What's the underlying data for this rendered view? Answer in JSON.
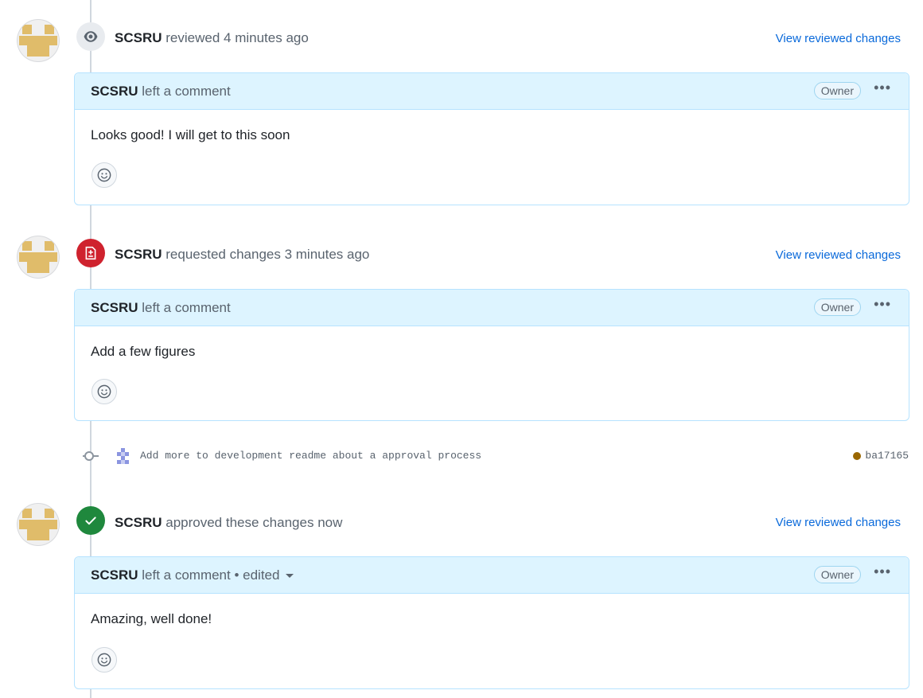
{
  "reviews": [
    {
      "author": "SCSRU",
      "action": "reviewed",
      "time": "4 minutes ago",
      "view_link": "View reviewed changes",
      "comment_author": "SCSRU",
      "comment_action": "left a comment",
      "role": "Owner",
      "body": "Looks good! I will get to this soon",
      "icon": "eye-icon"
    },
    {
      "author": "SCSRU",
      "action": "requested changes",
      "time": "3 minutes ago",
      "view_link": "View reviewed changes",
      "comment_author": "SCSRU",
      "comment_action": "left a comment",
      "role": "Owner",
      "body": "Add a few figures",
      "icon": "file-diff-icon"
    },
    {
      "author": "SCSRU",
      "action": "approved these changes",
      "time": "now",
      "view_link": "View reviewed changes",
      "comment_author": "SCSRU",
      "comment_action": "left a comment • edited",
      "role": "Owner",
      "body": "Amazing, well done!",
      "icon": "check-icon"
    }
  ],
  "commit": {
    "message": "Add more to development readme about a approval process",
    "sha": "ba17165",
    "status_color": "#9a6700"
  },
  "colors": {
    "link": "#0969da",
    "header_bg": "#ddf4ff",
    "request_changes": "#cf222e",
    "approved": "#1f883d"
  }
}
